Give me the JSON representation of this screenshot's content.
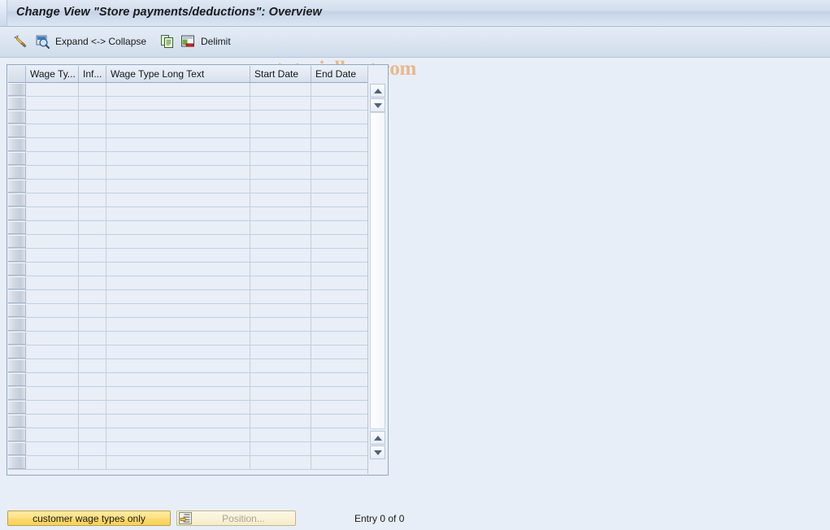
{
  "window": {
    "title": "Change View \"Store payments/deductions\": Overview"
  },
  "toolbar": {
    "items": [
      {
        "name": "display-change-icon",
        "label": ""
      },
      {
        "name": "display-icon",
        "label": ""
      },
      {
        "name": "expand-collapse",
        "label": "Expand <-> Collapse"
      },
      {
        "name": "copy-as-icon",
        "label": ""
      },
      {
        "name": "delimit-icon",
        "label": ""
      },
      {
        "name": "delimit",
        "label": "Delimit"
      }
    ],
    "expand_collapse_label": "Expand <-> Collapse",
    "delimit_label": "Delimit"
  },
  "watermark": {
    "text": "www.tutorialkart.com",
    "color": "#e7b98c"
  },
  "table": {
    "columns": [
      {
        "key": "select",
        "label": ""
      },
      {
        "key": "wage_type",
        "label": "Wage Ty..."
      },
      {
        "key": "infotype",
        "label": "Inf..."
      },
      {
        "key": "long_text",
        "label": "Wage Type Long Text"
      },
      {
        "key": "start_date",
        "label": "Start Date"
      },
      {
        "key": "end_date",
        "label": "End Date"
      },
      {
        "key": "config",
        "label": ""
      }
    ],
    "config_icon": "table-settings-icon",
    "rows": [],
    "empty_row_count": 28,
    "scrollbar": {
      "up_top": "scroll-up-icon",
      "down_top": "scroll-down-icon",
      "up_bottom": "scroll-up-icon",
      "down_bottom": "scroll-down-icon"
    }
  },
  "footer": {
    "customer_button_label": "customer wage types only",
    "position_button_label": "Position...",
    "position_icon": "goto-position-icon",
    "entry_status": "Entry 0 of 0"
  },
  "colors": {
    "background": "#e8eef7",
    "title_bar": "#d2dded",
    "grid_border": "#8fa8c4",
    "accent_yellow": "#fcd96f"
  }
}
